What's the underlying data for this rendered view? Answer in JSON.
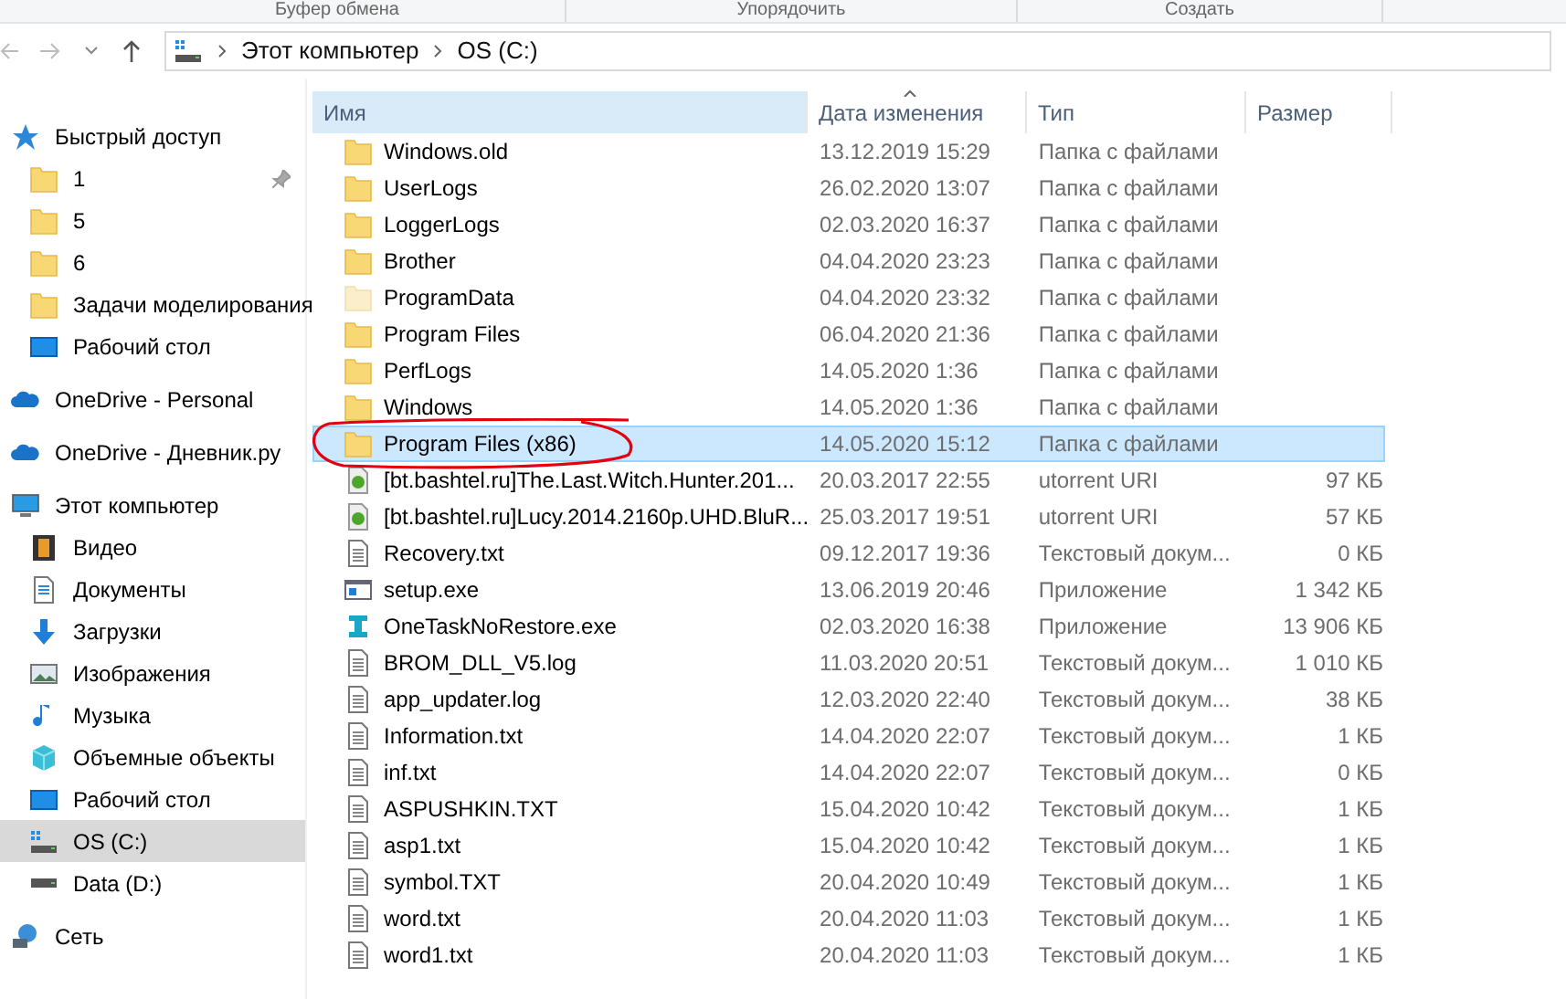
{
  "ribbon_groups": [
    "Буфер обмена",
    "Упорядочить",
    "Создать"
  ],
  "address_bar": {
    "path": [
      "Этот компьютер",
      "OS (C:)"
    ]
  },
  "sidebar": {
    "sections": [
      {
        "label": "Быстрый доступ",
        "kind": "star",
        "selected": false,
        "children": [
          {
            "label": "1",
            "kind": "folder",
            "pinned": true,
            "selected": false
          },
          {
            "label": "5",
            "kind": "folder",
            "pinned": false,
            "selected": false
          },
          {
            "label": "6",
            "kind": "folder",
            "pinned": false,
            "selected": false
          },
          {
            "label": "Задачи моделирования",
            "kind": "folder",
            "pinned": false,
            "selected": false
          },
          {
            "label": "Рабочий стол",
            "kind": "desktop",
            "pinned": false,
            "selected": false
          }
        ]
      },
      {
        "label": "OneDrive - Personal",
        "kind": "cloud",
        "selected": false
      },
      {
        "label": "OneDrive - Дневник.ру",
        "kind": "cloud",
        "selected": false
      },
      {
        "label": "Этот компьютер",
        "kind": "computer",
        "selected": false,
        "children": [
          {
            "label": "Видео",
            "kind": "video",
            "pinned": false,
            "selected": false
          },
          {
            "label": "Документы",
            "kind": "document",
            "pinned": false,
            "selected": false
          },
          {
            "label": "Загрузки",
            "kind": "download",
            "pinned": false,
            "selected": false
          },
          {
            "label": "Изображения",
            "kind": "image",
            "pinned": false,
            "selected": false
          },
          {
            "label": "Музыка",
            "kind": "music",
            "pinned": false,
            "selected": false
          },
          {
            "label": "Объемные объекты",
            "kind": "cube",
            "pinned": false,
            "selected": false
          },
          {
            "label": "Рабочий стол",
            "kind": "desktop",
            "pinned": false,
            "selected": false
          },
          {
            "label": "OS (C:)",
            "kind": "windrive",
            "pinned": false,
            "selected": true
          },
          {
            "label": "Data (D:)",
            "kind": "drive",
            "pinned": false,
            "selected": false
          }
        ]
      },
      {
        "label": "Сеть",
        "kind": "network",
        "selected": false
      }
    ]
  },
  "table": {
    "columns": [
      {
        "label": "Имя",
        "sorted": false
      },
      {
        "label": "Дата изменения",
        "sorted": true
      },
      {
        "label": "Тип",
        "sorted": false
      },
      {
        "label": "Размер",
        "sorted": false
      }
    ],
    "rows": [
      {
        "name": "Windows.old",
        "date": "13.12.2019 15:29",
        "type": "Папка с файлами",
        "kind": "folder",
        "selected": false
      },
      {
        "name": "UserLogs",
        "date": "26.02.2020 13:07",
        "type": "Папка с файлами",
        "kind": "folder",
        "selected": false
      },
      {
        "name": "LoggerLogs",
        "date": "02.03.2020 16:37",
        "type": "Папка с файлами",
        "kind": "folder",
        "selected": false
      },
      {
        "name": "Brother",
        "date": "04.04.2020 23:23",
        "type": "Папка с файлами",
        "kind": "folder",
        "selected": false
      },
      {
        "name": "ProgramData",
        "date": "04.04.2020 23:32",
        "type": "Папка с файлами",
        "kind": "hidden_folder",
        "selected": false
      },
      {
        "name": "Program Files",
        "date": "06.04.2020 21:36",
        "type": "Папка с файлами",
        "kind": "folder",
        "selected": false
      },
      {
        "name": "PerfLogs",
        "date": "14.05.2020 1:36",
        "type": "Папка с файлами",
        "kind": "folder",
        "selected": false
      },
      {
        "name": "Windows",
        "date": "14.05.2020 1:36",
        "type": "Папка с файлами",
        "kind": "folder",
        "selected": false
      },
      {
        "name": "Program Files (x86)",
        "date": "14.05.2020 15:12",
        "type": "Папка с файлами",
        "kind": "folder",
        "selected": true
      },
      {
        "name": "[bt.bashtel.ru]The.Last.Witch.Hunter.201...",
        "date": "20.03.2017 22:55",
        "type": "utorrent URI",
        "size": "97 КБ",
        "kind": "torrent",
        "selected": false
      },
      {
        "name": "[bt.bashtel.ru]Lucy.2014.2160p.UHD.BluR...",
        "date": "25.03.2017 19:51",
        "type": "utorrent URI",
        "size": "57 КБ",
        "kind": "torrent",
        "selected": false
      },
      {
        "name": "Recovery.txt",
        "date": "09.12.2017 19:36",
        "type": "Текстовый докум...",
        "size": "0 КБ",
        "kind": "text",
        "selected": false
      },
      {
        "name": "setup.exe",
        "date": "13.06.2019 20:46",
        "type": "Приложение",
        "size": "1 342 КБ",
        "kind": "window_app",
        "selected": false
      },
      {
        "name": "OneTaskNoRestore.exe",
        "date": "02.03.2020 16:38",
        "type": "Приложение",
        "size": "13 906 КБ",
        "kind": "custom_app",
        "selected": false
      },
      {
        "name": "BROM_DLL_V5.log",
        "date": "11.03.2020 20:51",
        "type": "Текстовый докум...",
        "size": "1 010 КБ",
        "kind": "text",
        "selected": false
      },
      {
        "name": "app_updater.log",
        "date": "12.03.2020 22:40",
        "type": "Текстовый докум...",
        "size": "38 КБ",
        "kind": "text",
        "selected": false
      },
      {
        "name": "Information.txt",
        "date": "14.04.2020 22:07",
        "type": "Текстовый докум...",
        "size": "1 КБ",
        "kind": "text",
        "selected": false
      },
      {
        "name": "inf.txt",
        "date": "14.04.2020 22:07",
        "type": "Текстовый докум...",
        "size": "0 КБ",
        "kind": "text",
        "selected": false
      },
      {
        "name": "ASPUSHKIN.TXT",
        "date": "15.04.2020 10:42",
        "type": "Текстовый докум...",
        "size": "1 КБ",
        "kind": "text",
        "selected": false
      },
      {
        "name": "asp1.txt",
        "date": "15.04.2020 10:42",
        "type": "Текстовый докум...",
        "size": "1 КБ",
        "kind": "text",
        "selected": false
      },
      {
        "name": "symbol.TXT",
        "date": "20.04.2020 10:49",
        "type": "Текстовый докум...",
        "size": "1 КБ",
        "kind": "text",
        "selected": false
      },
      {
        "name": "word.txt",
        "date": "20.04.2020 11:03",
        "type": "Текстовый докум...",
        "size": "1 КБ",
        "kind": "text",
        "selected": false
      },
      {
        "name": "word1.txt",
        "date": "20.04.2020 11:03",
        "type": "Текстовый докум...",
        "size": "1 КБ",
        "kind": "text",
        "selected": false
      }
    ]
  },
  "annotation": {
    "kind": "hand_drawn_circle",
    "color": "#e3000f"
  }
}
